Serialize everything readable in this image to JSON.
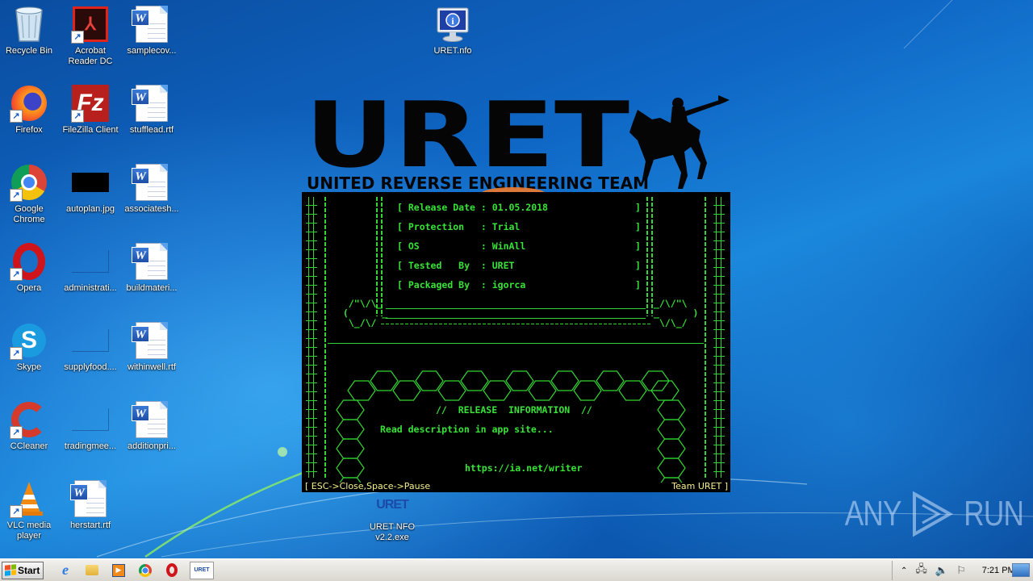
{
  "desktop": {
    "icons": [
      {
        "id": "recycle-bin",
        "label": "Recycle Bin",
        "type": "recycle-bin"
      },
      {
        "id": "acrobat",
        "label": "Acrobat\nReader DC",
        "type": "acrobat",
        "shortcut": true
      },
      {
        "id": "samplecov",
        "label": "samplecov...",
        "type": "word"
      },
      {
        "id": "firefox",
        "label": "Firefox",
        "type": "firefox",
        "shortcut": true
      },
      {
        "id": "filezilla",
        "label": "FileZilla Client",
        "type": "filezilla",
        "shortcut": true
      },
      {
        "id": "stufflead",
        "label": "stufflead.rtf",
        "type": "word"
      },
      {
        "id": "chrome",
        "label": "Google\nChrome",
        "type": "chrome",
        "shortcut": true
      },
      {
        "id": "autoplan",
        "label": "autoplan.jpg",
        "type": "black-image"
      },
      {
        "id": "associatesh",
        "label": "associatesh...",
        "type": "word"
      },
      {
        "id": "opera",
        "label": "Opera",
        "type": "opera",
        "shortcut": true
      },
      {
        "id": "administrati",
        "label": "administrati...",
        "type": "blank"
      },
      {
        "id": "buildmateri",
        "label": "buildmateri...",
        "type": "word"
      },
      {
        "id": "skype",
        "label": "Skype",
        "type": "skype",
        "shortcut": true
      },
      {
        "id": "supplyfood",
        "label": "supplyfood....",
        "type": "blank"
      },
      {
        "id": "withinwell",
        "label": "withinwell.rtf",
        "type": "word"
      },
      {
        "id": "ccleaner",
        "label": "CCleaner",
        "type": "ccleaner",
        "shortcut": true
      },
      {
        "id": "tradingmee",
        "label": "tradingmee...",
        "type": "blank"
      },
      {
        "id": "additionpri",
        "label": "additionpri...",
        "type": "word"
      },
      {
        "id": "vlc",
        "label": "VLC media\nplayer",
        "type": "vlc",
        "shortcut": true
      },
      {
        "id": "herstart",
        "label": "herstart.rtf",
        "type": "word"
      },
      {
        "id": "uret-nfo-file",
        "label": "URET.nfo",
        "type": "nfo"
      },
      {
        "id": "uret-nfo-exe",
        "label": "URET NFO\nv2.2.exe",
        "type": "uret-exe"
      }
    ]
  },
  "splash": {
    "logo_title": "URET",
    "logo_subtitle": "UNITED REVERSE ENGINEERING TEAM",
    "info": [
      {
        "key": "Release Date",
        "value": "01.05.2018"
      },
      {
        "key": "Protection  ",
        "value": "Trial"
      },
      {
        "key": "OS          ",
        "value": "WinAll"
      },
      {
        "key": "Tested   By ",
        "value": "URET"
      },
      {
        "key": "Packaged By ",
        "value": "igorca"
      }
    ],
    "release_heading": "//  RELEASE  INFORMATION  //",
    "description": "Read description in app site...",
    "url": "https://ia.net/writer",
    "footer_left": "[ ESC->Close,Space->Pause",
    "footer_right": "Team URET ]",
    "text_color": "#37e337",
    "footer_color": "#f4f08a"
  },
  "watermark": {
    "left": "ANY",
    "right": "RUN"
  },
  "taskbar": {
    "start_label": "Start",
    "pinned": [
      {
        "id": "ie",
        "name": "Internet Explorer"
      },
      {
        "id": "explorer",
        "name": "Windows Explorer"
      },
      {
        "id": "media",
        "name": "Windows Media Player"
      },
      {
        "id": "chrome",
        "name": "Google Chrome"
      },
      {
        "id": "opera",
        "name": "Opera"
      },
      {
        "id": "uret",
        "name": "URET NFO v2.2",
        "active": true
      }
    ],
    "tray": {
      "icons": [
        "show-hidden-icons",
        "network",
        "volume",
        "action-center-flag"
      ],
      "clock": "7:21 PM"
    }
  }
}
